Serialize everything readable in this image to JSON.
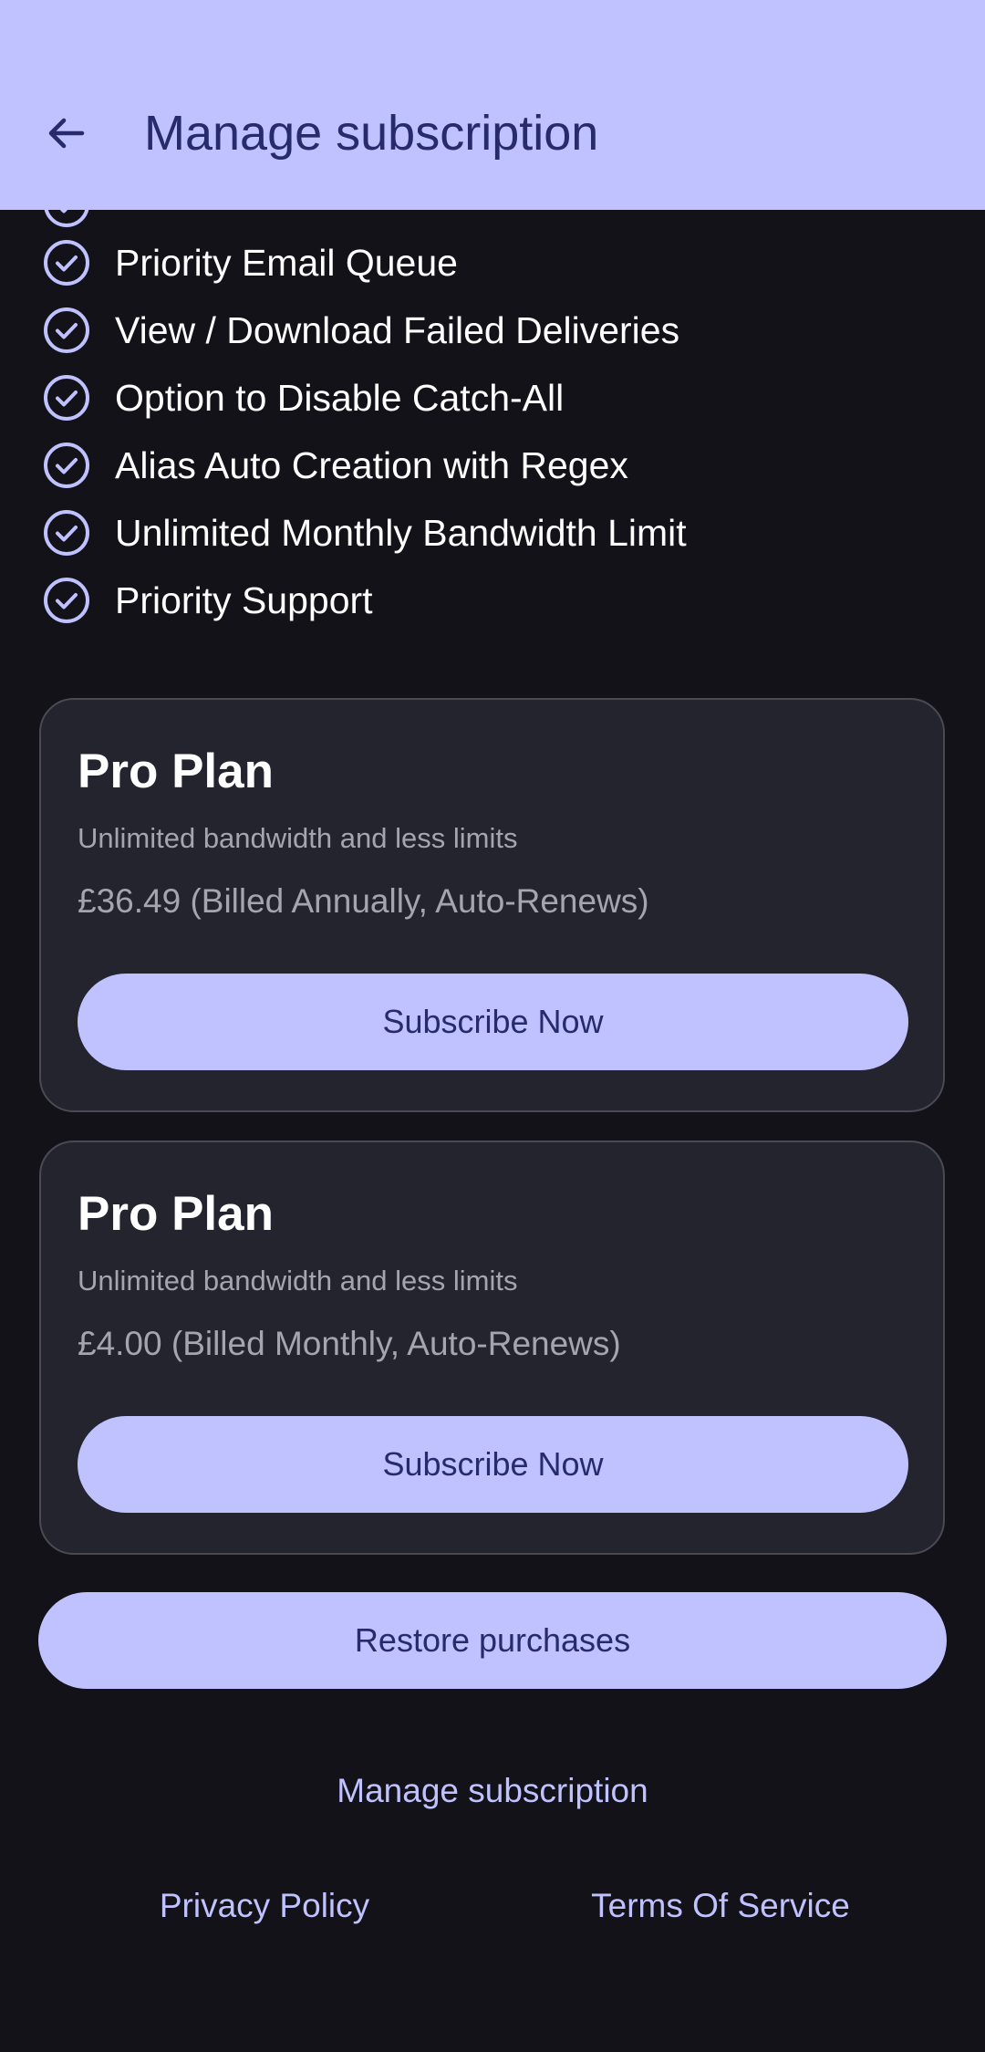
{
  "app_bar": {
    "title": "Manage subscription",
    "back_icon": "arrow-left-icon"
  },
  "colors": {
    "app_bar_bg": "#bfc2ff",
    "app_bar_text": "#272a6b",
    "background": "#131218",
    "card_bg": "#24242f",
    "accent": "#bfc2ff",
    "muted_text": "#a6a4b0"
  },
  "features": {
    "icon": "check-circle-icon",
    "items": [
      {
        "label": "Priority Email Queue"
      },
      {
        "label": "View / Download Failed Deliveries"
      },
      {
        "label": "Option to Disable Catch-All"
      },
      {
        "label": "Alias Auto Creation with Regex"
      },
      {
        "label": "Unlimited Monthly Bandwidth Limit"
      },
      {
        "label": "Priority Support"
      }
    ]
  },
  "plans": [
    {
      "name": "Pro Plan",
      "description": "Unlimited bandwidth and less limits",
      "price": "£36.49 (Billed Annually, Auto-Renews)",
      "button_label": "Subscribe Now"
    },
    {
      "name": "Pro Plan",
      "description": "Unlimited bandwidth and less limits",
      "price": "£4.00 (Billed Monthly, Auto-Renews)",
      "button_label": "Subscribe Now"
    }
  ],
  "restore_label": "Restore purchases",
  "footer": {
    "manage_label": "Manage subscription",
    "privacy_label": "Privacy Policy",
    "terms_label": "Terms Of Service"
  }
}
